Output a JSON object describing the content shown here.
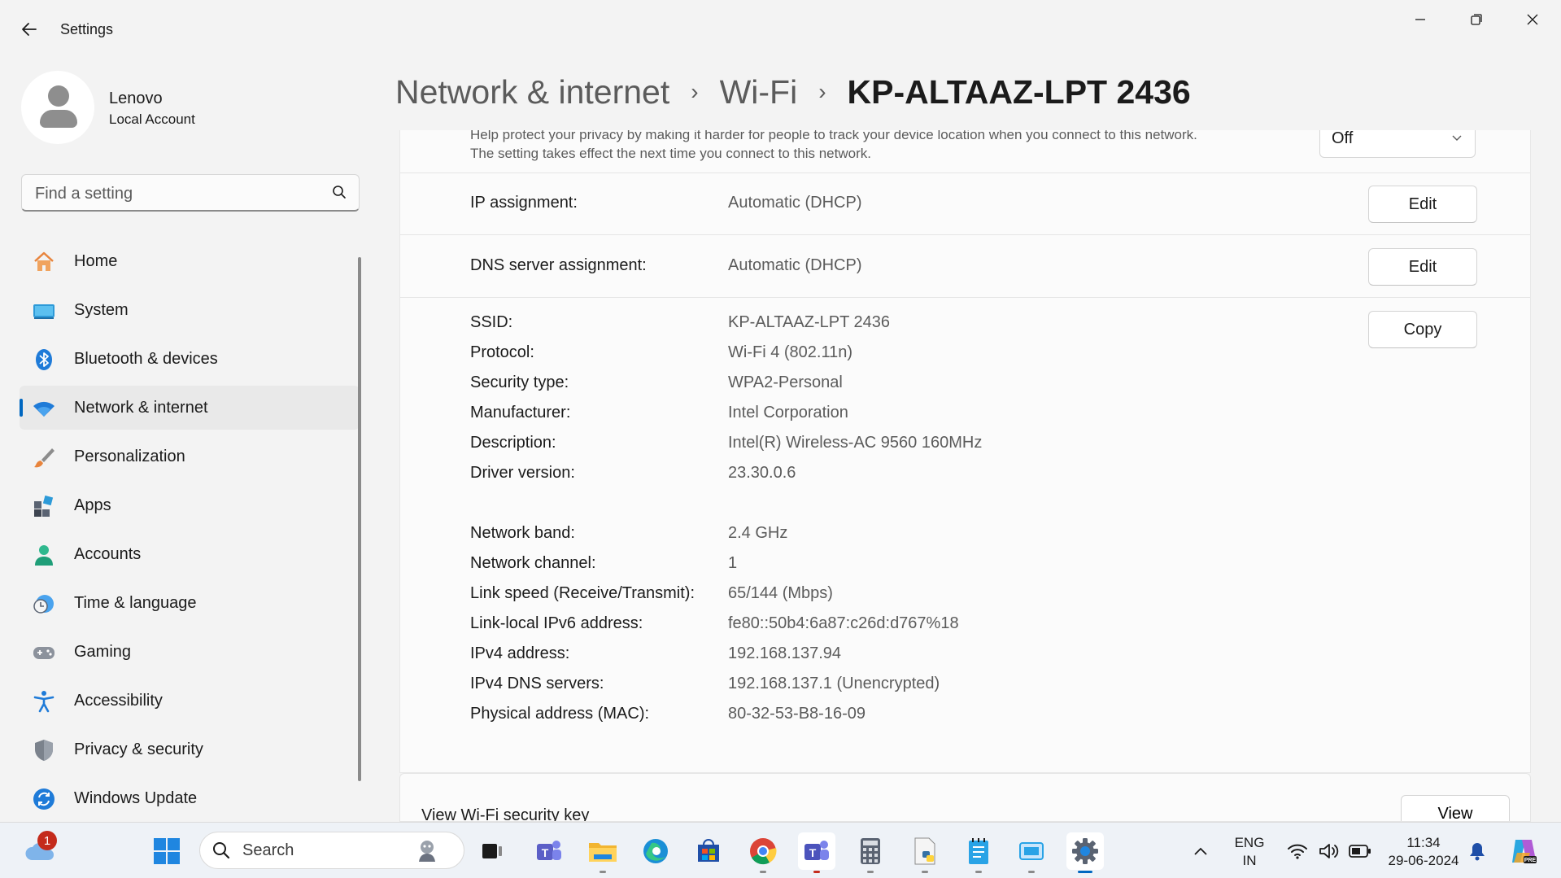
{
  "app": {
    "title": "Settings"
  },
  "profile": {
    "name": "Lenovo",
    "account_type": "Local Account"
  },
  "search": {
    "placeholder": "Find a setting"
  },
  "sidebar": {
    "items": [
      {
        "label": "Home",
        "icon": "home-icon",
        "active": false
      },
      {
        "label": "System",
        "icon": "system-icon",
        "active": false
      },
      {
        "label": "Bluetooth & devices",
        "icon": "bluetooth-icon",
        "active": false
      },
      {
        "label": "Network & internet",
        "icon": "wifi-icon",
        "active": true
      },
      {
        "label": "Personalization",
        "icon": "brush-icon",
        "active": false
      },
      {
        "label": "Apps",
        "icon": "apps-icon",
        "active": false
      },
      {
        "label": "Accounts",
        "icon": "accounts-icon",
        "active": false
      },
      {
        "label": "Time & language",
        "icon": "clock-globe-icon",
        "active": false
      },
      {
        "label": "Gaming",
        "icon": "gamepad-icon",
        "active": false
      },
      {
        "label": "Accessibility",
        "icon": "accessibility-icon",
        "active": false
      },
      {
        "label": "Privacy & security",
        "icon": "shield-icon",
        "active": false
      },
      {
        "label": "Windows Update",
        "icon": "update-icon",
        "active": false
      }
    ]
  },
  "breadcrumb": {
    "items": [
      "Network & internet",
      "Wi-Fi"
    ],
    "current": "KP-ALTAAZ-LPT 2436"
  },
  "privacy": {
    "line1": "Help protect your privacy by making it harder for people to track your device location when you connect to this network.",
    "line2": "The setting takes effect the next time you connect to this network.",
    "dropdown_value": "Off"
  },
  "assignments": {
    "ip_label": "IP assignment:",
    "ip_value": "Automatic (DHCP)",
    "ip_button": "Edit",
    "dns_label": "DNS server assignment:",
    "dns_value": "Automatic (DHCP)",
    "dns_button": "Edit"
  },
  "properties": {
    "copy_button": "Copy",
    "rows": [
      {
        "label": "SSID:",
        "value": "KP-ALTAAZ-LPT 2436"
      },
      {
        "label": "Protocol:",
        "value": "Wi-Fi 4 (802.11n)"
      },
      {
        "label": "Security type:",
        "value": "WPA2-Personal"
      },
      {
        "label": "Manufacturer:",
        "value": "Intel Corporation"
      },
      {
        "label": "Description:",
        "value": "Intel(R) Wireless-AC 9560 160MHz"
      },
      {
        "label": "Driver version:",
        "value": "23.30.0.6"
      },
      {
        "label": "Network band:",
        "value": "2.4 GHz"
      },
      {
        "label": "Network channel:",
        "value": "1"
      },
      {
        "label": "Link speed (Receive/Transmit):",
        "value": "65/144 (Mbps)"
      },
      {
        "label": "Link-local IPv6 address:",
        "value": "fe80::50b4:6a87:c26d:d767%18"
      },
      {
        "label": "IPv4 address:",
        "value": "192.168.137.94"
      },
      {
        "label": "IPv4 DNS servers:",
        "value": "192.168.137.1 (Unencrypted)"
      },
      {
        "label": "Physical address (MAC):",
        "value": "80-32-53-B8-16-09"
      }
    ]
  },
  "security_key": {
    "label": "View Wi-Fi security key",
    "button": "View"
  },
  "taskbar": {
    "search_label": "Search",
    "weather_badge": "1",
    "language_line1": "ENG",
    "language_line2": "IN",
    "time": "11:34",
    "date": "29-06-2024"
  },
  "colors": {
    "accent": "#0067c0",
    "background": "#f3f3f3",
    "card": "#fbfbfb"
  }
}
